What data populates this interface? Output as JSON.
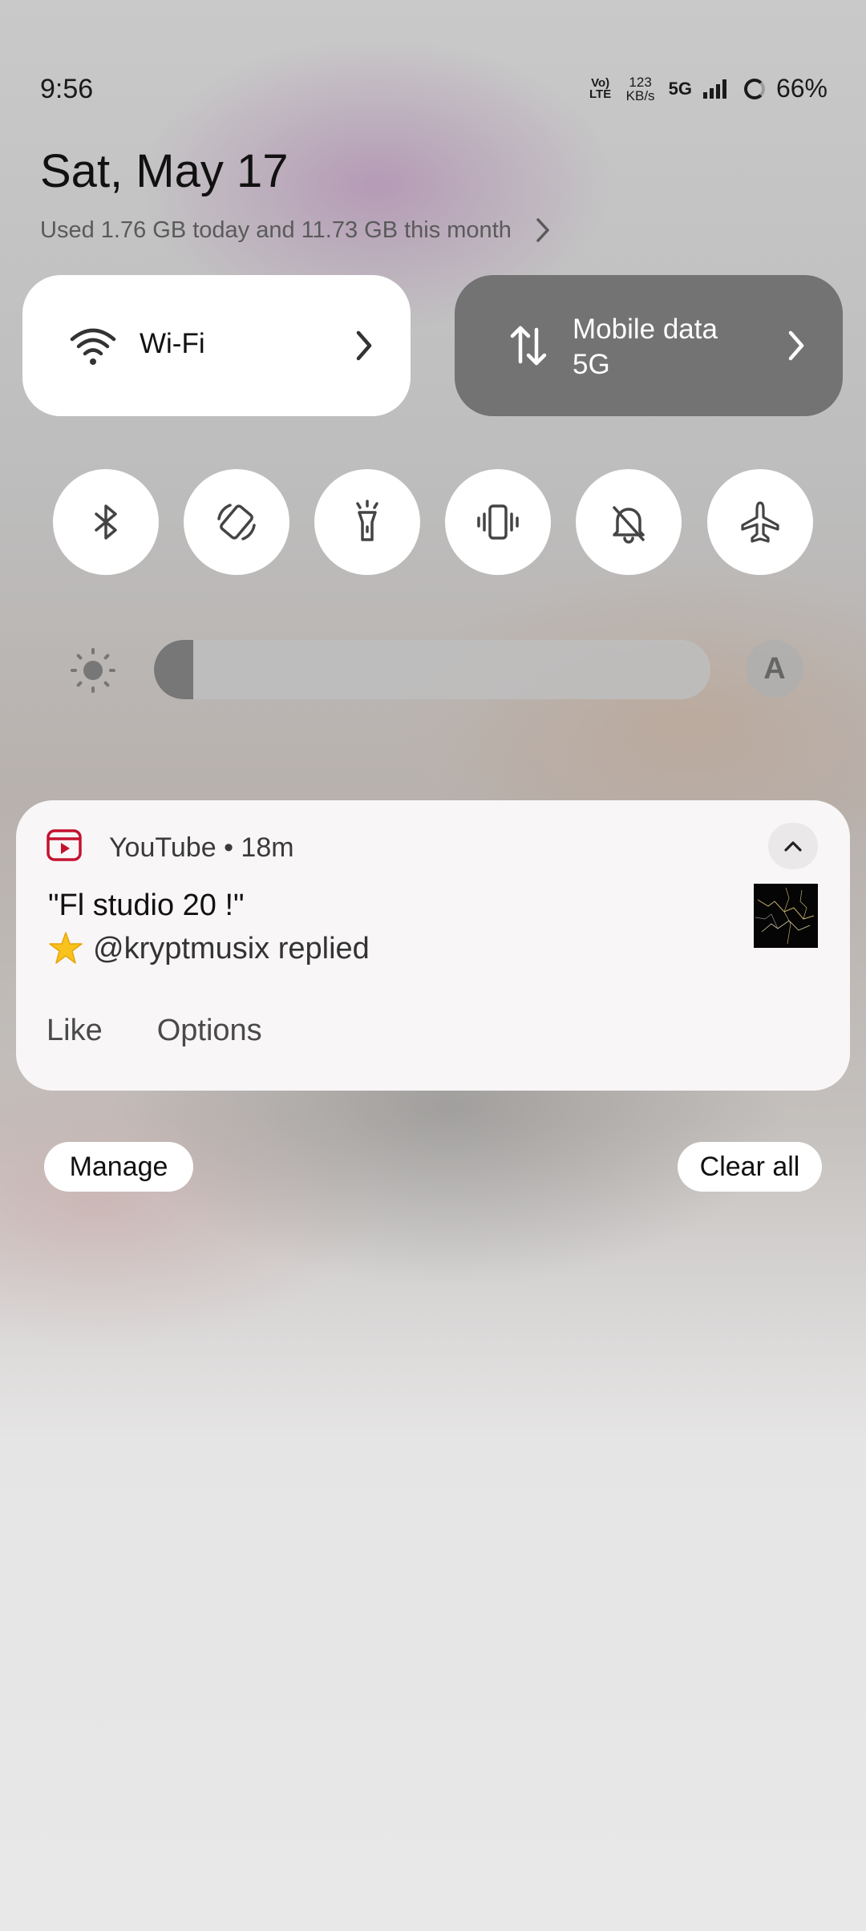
{
  "status_bar": {
    "time": "9:56",
    "volte": "Vo) LTE",
    "speed_value": "123",
    "speed_unit": "KB/s",
    "network": "5G",
    "battery": "66%"
  },
  "header": {
    "date": "Sat, May 17",
    "usage": "Used 1.76 GB today and 11.73 GB this month"
  },
  "tiles": {
    "wifi": {
      "label": "Wi-Fi",
      "icon": "wifi-icon"
    },
    "mobile": {
      "label_line1": "Mobile data",
      "label_line2": "5G",
      "icon": "data-arrows-icon"
    }
  },
  "toggles": [
    {
      "name": "bluetooth",
      "icon": "bluetooth-icon"
    },
    {
      "name": "auto-rotate",
      "icon": "rotate-icon"
    },
    {
      "name": "flashlight",
      "icon": "flashlight-icon"
    },
    {
      "name": "vibrate",
      "icon": "vibrate-icon"
    },
    {
      "name": "do-not-disturb",
      "icon": "bell-off-icon"
    },
    {
      "name": "airplane-mode",
      "icon": "airplane-icon"
    }
  ],
  "brightness": {
    "level_fraction": 0.07,
    "auto_label": "A"
  },
  "notification": {
    "app": "YouTube",
    "separator": "•",
    "time": "18m",
    "title": "\"Fl studio 20 !\"",
    "body": "@kryptmusix replied",
    "actions": [
      "Like",
      "Options"
    ],
    "accent": "#c4122f"
  },
  "footer": {
    "manage_label": "Manage",
    "clear_label": "Clear all"
  }
}
